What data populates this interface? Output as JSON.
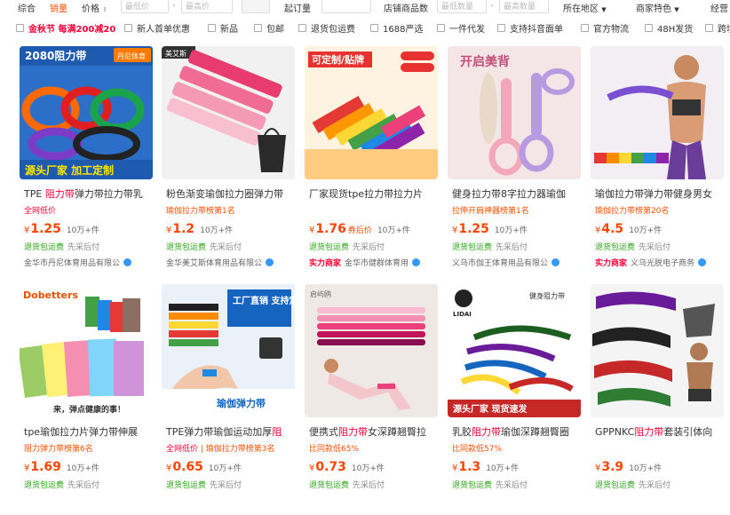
{
  "toolbar": {
    "sort_comprehensive": "综合",
    "sort_sales": "销量",
    "sort_price": "价格",
    "price_min_placeholder": "最低价",
    "price_max_placeholder": "最高价",
    "moq_label": "起订量",
    "shop_items_label": "店铺商品数",
    "items_min_placeholder": "最低数量",
    "items_max_placeholder": "最高数量",
    "region": "所在地区",
    "merchant_features": "商家特色",
    "business": "经营"
  },
  "filters": {
    "promo": "金秋节 每满200减20",
    "items": [
      "新人首单优惠",
      "新品",
      "包邮",
      "退货包运费",
      "1688严选",
      "一件代发",
      "支持抖音面单",
      "官方物流",
      "48H发货",
      "跨境"
    ]
  },
  "products": [
    {
      "title_hl": "TPE",
      "title_red": "阻力带",
      "title_rest": "弹力带拉力带乳",
      "tag": "全网低价",
      "price": "1.25",
      "price_tag": "",
      "sold": "10万+件",
      "service": "退货包运费",
      "pay": "先采后付",
      "shop": "金华市丹尼体育用品有限公",
      "strength": "",
      "img_text": "2080阻力带",
      "img_sub": "源头厂家 加工定制",
      "brand": "丹尼体育"
    },
    {
      "title_hl": "粉色渐变瑜伽拉力圈弹力带",
      "title_red": "",
      "title_rest": "",
      "tag": "瑜伽拉力带榜第1名",
      "price": "1.2",
      "price_tag": "",
      "sold": "10万+件",
      "service": "退货包运费",
      "pay": "先采后付",
      "shop": "金华美艾斯体育用品有限公",
      "strength": "",
      "img_text": "",
      "img_sub": "",
      "brand": "美艾斯"
    },
    {
      "title_hl": "厂家现货tpe拉力带拉力片",
      "title_red": "",
      "title_rest": "",
      "tag": "",
      "price": "1.76",
      "price_tag": "券后价",
      "sold": "10万+件",
      "service": "退货包运费",
      "pay": "先采后付",
      "shop": "金华市健群体育用",
      "strength": "实力商家",
      "img_text": "可定制/贴牌",
      "img_sub": "",
      "brand": ""
    },
    {
      "title_hl": "健身拉力带8字拉力器瑜伽",
      "title_red": "",
      "title_rest": "",
      "tag": "拉伸开肩神器榜第1名",
      "price": "1.25",
      "price_tag": "",
      "sold": "10万+件",
      "service": "退货包运费",
      "pay": "先采后付",
      "shop": "义乌市伽王体育用品有限公",
      "strength": "",
      "img_text": "开启美背",
      "img_sub": "",
      "brand": ""
    },
    {
      "title_hl": "瑜伽拉力带弹力带健身男女",
      "title_red": "",
      "title_rest": "",
      "tag": "瑜伽拉力带榜第20名",
      "price": "4.5",
      "price_tag": "",
      "sold": "10万+件",
      "service": "退货包运费",
      "pay": "先采后付",
      "shop": "义乌光脱电子商务",
      "strength": "实力商家",
      "img_text": "",
      "img_sub": "",
      "brand": ""
    },
    {
      "title_hl": "tpe瑜伽拉力片弹力带伸展",
      "title_red": "",
      "title_rest": "",
      "tag": "阻力弹力带榜第6名",
      "price": "1.69",
      "price_tag": "",
      "sold": "10万+件",
      "service": "退货包运费",
      "pay": "先采后付",
      "shop": "",
      "strength": "",
      "img_text": "Dobetters",
      "img_sub": "来，弹点健康的事！",
      "brand": ""
    },
    {
      "title_hl": "TPE弹力带瑜伽运动加厚",
      "title_red": "阻",
      "title_rest": "",
      "tag": "全网低价",
      "tag2": "瑜伽拉力带榜第3名",
      "price": "0.65",
      "price_tag": "",
      "sold": "10万+件",
      "service": "退货包运费",
      "pay": "先采后付",
      "shop": "",
      "strength": "",
      "img_text": "工厂直销 支持定制",
      "img_sub": "瑜伽弹力带",
      "brand": ""
    },
    {
      "title_hl": "便携式",
      "title_red": "阻力带",
      "title_rest": "女深蹲翘臀拉",
      "tag": "比同款低65%",
      "price": "0.73",
      "price_tag": "",
      "sold": "10万+件",
      "service": "退货包运费",
      "pay": "先采后付",
      "shop": "",
      "strength": "",
      "img_text": "启屿鸥",
      "img_sub": "",
      "brand": ""
    },
    {
      "title_hl": "乳胶",
      "title_red": "阻力带",
      "title_rest": "瑜伽深蹲翘臀圈",
      "tag": "比同款低57%",
      "price": "1.3",
      "price_tag": "",
      "sold": "10万+件",
      "service": "退货包运费",
      "pay": "先采后付",
      "shop": "",
      "strength": "",
      "img_text": "健身阻力带",
      "img_sub": "源头厂家 现货速发",
      "brand": "LIDAI"
    },
    {
      "title_hl": "GPPNKC",
      "title_red": "阻力带",
      "title_rest": "套装引体向",
      "tag": "",
      "price": "3.9",
      "price_tag": "",
      "sold": "10万+件",
      "service": "退货包运费",
      "pay": "先采后付",
      "shop": "",
      "strength": "",
      "img_text": "",
      "img_sub": "",
      "brand": ""
    }
  ]
}
